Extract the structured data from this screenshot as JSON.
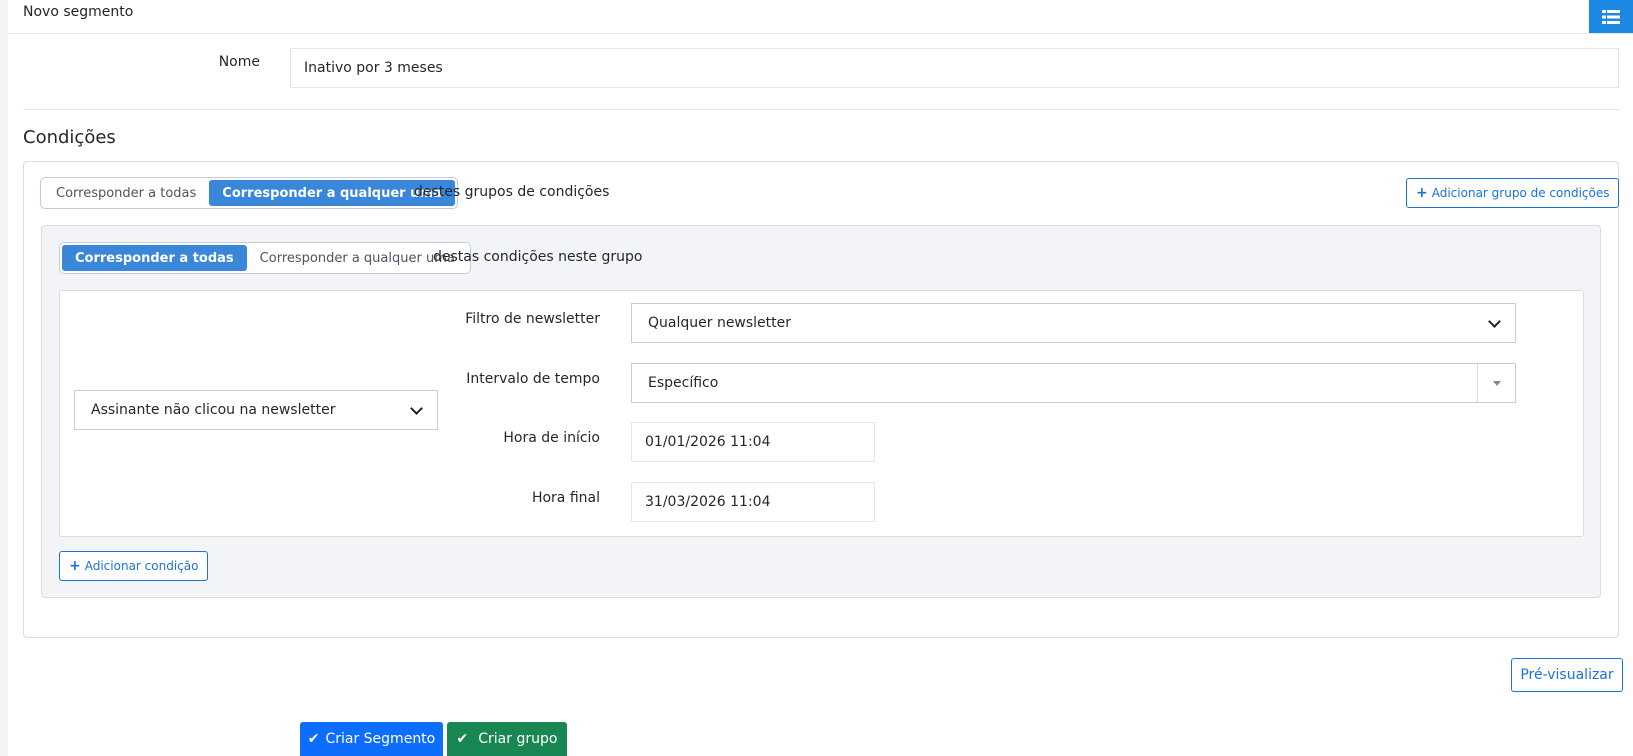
{
  "header": {
    "title": "Novo segmento"
  },
  "name_field": {
    "label": "Nome",
    "value": "Inativo por 3 meses"
  },
  "conditions": {
    "title": "Condições",
    "match_toggle": {
      "options": [
        "Corresponder a todas",
        "Corresponder a qualquer uma"
      ],
      "active": 1,
      "suffix": "destes grupos de condições"
    },
    "add_group_label": "Adicionar grupo de condições",
    "group": {
      "match_toggle": {
        "options": [
          "Corresponder a todas",
          "Corresponder a qualquer uma"
        ],
        "active": 0,
        "suffix": "destas condições neste grupo"
      },
      "condition": {
        "type_value": "Assinante não clicou na newsletter",
        "newsletter_filter": {
          "label": "Filtro de newsletter",
          "value": "Qualquer newsletter"
        },
        "time_interval": {
          "label": "Intervalo de tempo",
          "value": "Específico"
        },
        "start_time": {
          "label": "Hora de início",
          "value": "01/01/2026 11:04"
        },
        "end_time": {
          "label": "Hora final",
          "value": "31/03/2026 11:04"
        }
      },
      "add_condition_label": "Adicionar condição"
    }
  },
  "actions": {
    "preview_label": "Pré-visualizar",
    "create_segment_label": "Criar Segmento",
    "create_group_label": "Criar grupo"
  },
  "colors": {
    "primary": "#0d6efd",
    "success": "#198754",
    "toggle_active": "#3a87d9",
    "menu": "#1e88e5"
  },
  "icons": {
    "menu": "list-icon",
    "plus": "plus-icon",
    "check": "check-icon"
  }
}
